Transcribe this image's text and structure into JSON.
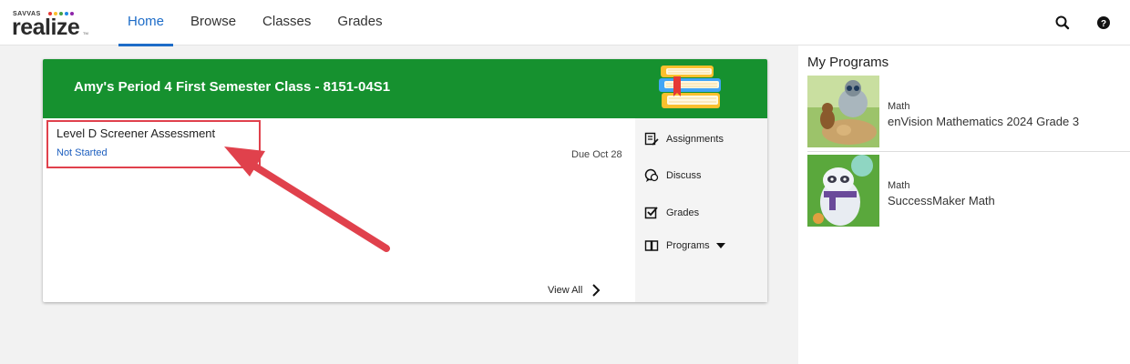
{
  "logo": {
    "brand": "SAVVAS",
    "word": "realize",
    "tm": "TM"
  },
  "nav": {
    "items": [
      {
        "label": "Home",
        "active": true
      },
      {
        "label": "Browse",
        "active": false
      },
      {
        "label": "Classes",
        "active": false
      },
      {
        "label": "Grades",
        "active": false
      }
    ],
    "icons": [
      "search-icon",
      "help-icon"
    ]
  },
  "class_card": {
    "title": "Amy's Period 4 First Semester Class - 8151-04S1",
    "header_color": "#16912f",
    "assignment": {
      "name": "Level D Screener Assessment",
      "status": "Not Started",
      "due": "Due Oct 28"
    },
    "view_all": "View All",
    "side_links": [
      {
        "label": "Assignments",
        "icon": "assignments-icon"
      },
      {
        "label": "Discuss",
        "icon": "discuss-icon"
      },
      {
        "label": "Grades",
        "icon": "grades-checkbox-icon"
      },
      {
        "label": "Programs",
        "icon": "book-icon",
        "dropdown": true
      }
    ]
  },
  "my_programs": {
    "title": "My Programs",
    "items": [
      {
        "subject": "Math",
        "title": "enVision Mathematics 2024 Grade 3"
      },
      {
        "subject": "Math",
        "title": "SuccessMaker Math"
      }
    ]
  },
  "colors": {
    "accent": "#1d6cc8",
    "header_green": "#16912f",
    "annotation_red": "#e0414c"
  }
}
